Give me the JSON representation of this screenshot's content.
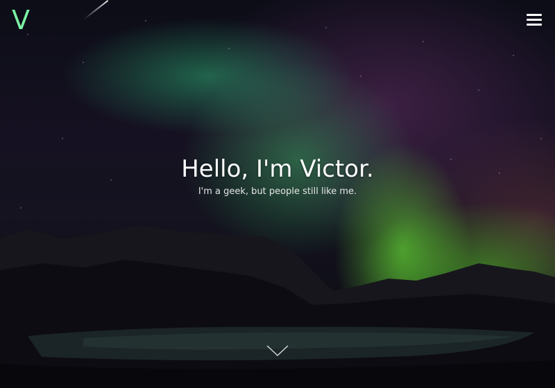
{
  "header": {
    "logo_text": "V",
    "logo_color": "#7cf3a4",
    "menu_icon": "hamburger-menu-icon"
  },
  "hero": {
    "title": "Hello, I'm Victor.",
    "subtitle": "I'm a geek, but people still like me.",
    "scroll_icon": "chevron-down-icon"
  }
}
